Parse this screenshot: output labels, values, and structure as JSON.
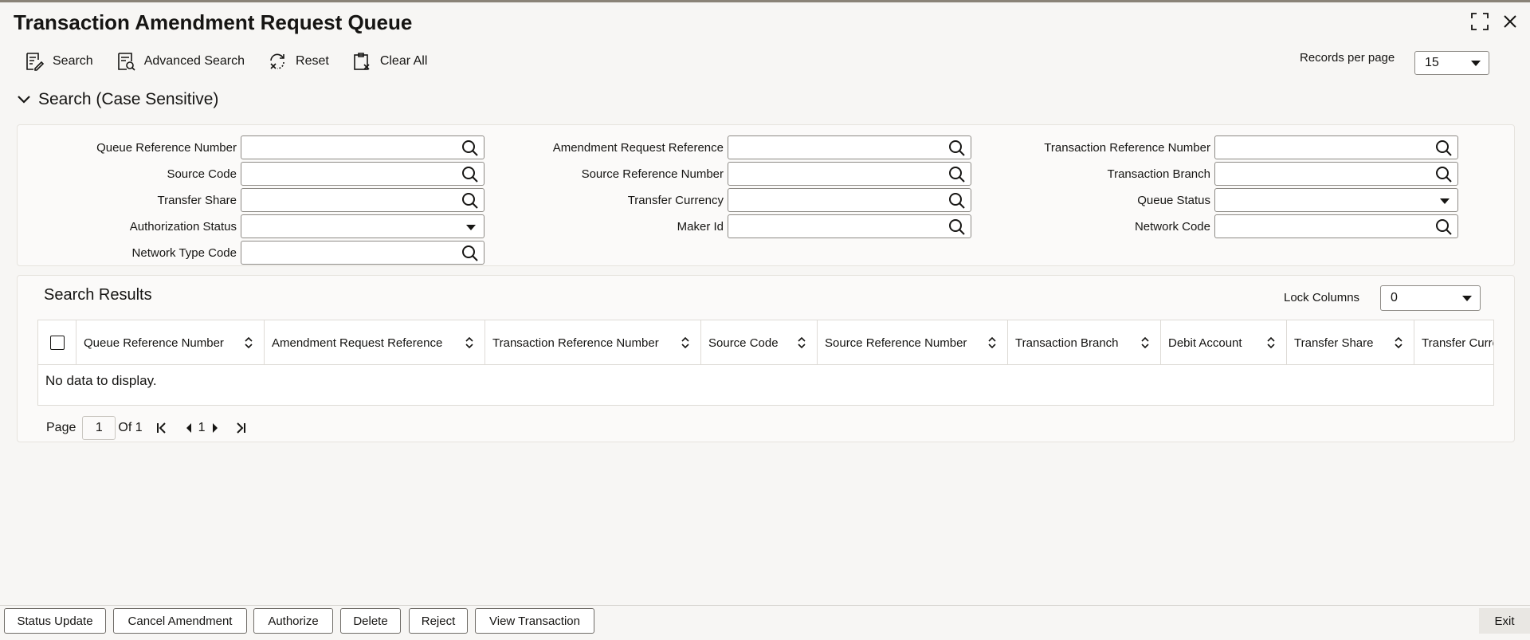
{
  "header": {
    "title": "Transaction Amendment Request Queue"
  },
  "toolbar": {
    "search_label": "Search",
    "advanced_search_label": "Advanced Search",
    "reset_label": "Reset",
    "clear_all_label": "Clear All",
    "records_per_page_label": "Records per page",
    "records_per_page_value": "15"
  },
  "search_section": {
    "title": "Search (Case Sensitive)",
    "fields": {
      "queue_reference_number": "Queue Reference Number",
      "amendment_request_reference": "Amendment Request Reference",
      "transaction_reference_number": "Transaction Reference Number",
      "source_code": "Source Code",
      "source_reference_number": "Source Reference Number",
      "transaction_branch": "Transaction Branch",
      "transfer_share": "Transfer Share",
      "transfer_currency": "Transfer Currency",
      "queue_status": "Queue Status",
      "authorization_status": "Authorization Status",
      "maker_id": "Maker Id",
      "network_code": "Network Code",
      "network_type_code": "Network Type Code"
    }
  },
  "results": {
    "title": "Search Results",
    "lock_columns_label": "Lock Columns",
    "lock_columns_value": "0",
    "columns": [
      "Queue Reference Number",
      "Amendment Request Reference",
      "Transaction Reference Number",
      "Source Code",
      "Source Reference Number",
      "Transaction Branch",
      "Debit Account",
      "Transfer Share",
      "Transfer Curre"
    ],
    "empty_message": "No data to display."
  },
  "pager": {
    "page_label": "Page",
    "page_value": "1",
    "of_label": "Of 1",
    "current_page": "1"
  },
  "footer": {
    "status_update": "Status Update",
    "cancel_amendment": "Cancel Amendment",
    "authorize": "Authorize",
    "delete": "Delete",
    "reject": "Reject",
    "view_transaction": "View Transaction",
    "exit": "Exit"
  }
}
